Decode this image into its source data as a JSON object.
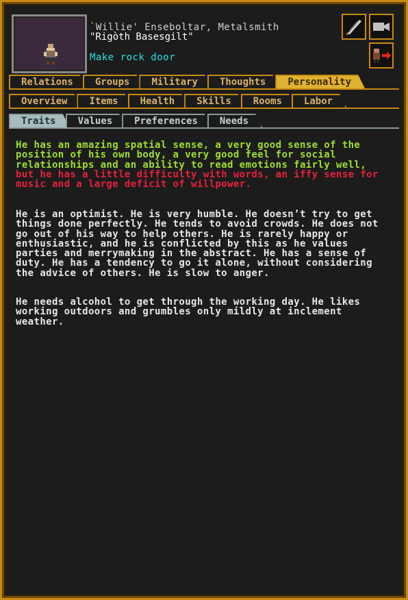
{
  "unit": {
    "name_line": "`Willie' Enseboltar, Metalsmith",
    "nickname_line": "\"Rigòth Basesgilt\"",
    "job": "Make rock door"
  },
  "tabs_row1": [
    "Relations",
    "Groups",
    "Military",
    "Thoughts",
    "Personality"
  ],
  "tabs_row2": [
    "Overview",
    "Items",
    "Health",
    "Skills",
    "Rooms",
    "Labor"
  ],
  "tabs_row3": [
    "Traits",
    "Values",
    "Preferences",
    "Needs"
  ],
  "active_tabs": {
    "row1": "Personality",
    "row3": "Traits"
  },
  "traits": {
    "positive": "He has an amazing spatial sense, a very good sense of the position of his own body, a very good feel for social relationships and an ability to read emotions fairly well,",
    "negative": " but he has a little difficulty with words, an iffy sense for music and a large deficit of willpower.",
    "personality": "He is an optimist. He is very humble. He doesn’t try to get things done perfectly. He tends to avoid crowds. He does not go out of his way to help others. He is rarely happy or enthusiastic, and he is conflicted by this as he values parties and merrymaking in the abstract. He has a sense of duty. He has a tendency to go it alone, without considering the advice of others. He is slow to anger.",
    "needs": "He needs alcohol to get through the working day. He likes working outdoors and grumbles only mildly at inclement weather."
  },
  "icons": [
    "quill-icon",
    "camera-icon",
    "dwarf-exit-icon"
  ],
  "colors": {
    "frame": "#c98a10",
    "active_tab": "#e0b030",
    "good_trait": "#9fe02c",
    "bad_trait": "#e8203c",
    "job": "#28e0e0"
  }
}
